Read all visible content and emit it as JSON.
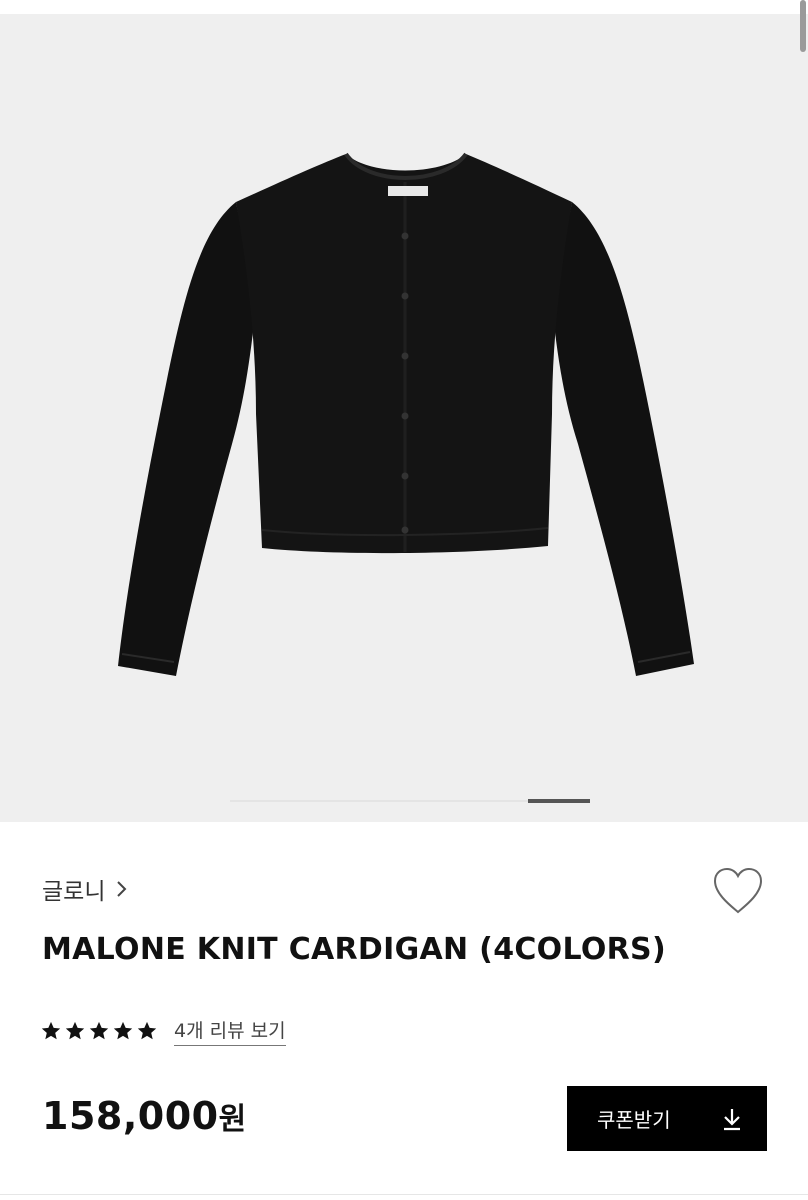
{
  "brand": {
    "name": "글로니",
    "chevron_icon": "chevron-right-icon"
  },
  "product": {
    "title": "MALONE KNIT CARDIGAN (4COLORS)",
    "image_icon": "black-knit-cardigan-photo",
    "rating_stars": 5,
    "review_link": "4개 리뷰 보기",
    "price": "158,000",
    "price_unit": "원"
  },
  "gallery": {
    "background": "#efefef",
    "active_slide_fraction": 0.83
  },
  "wishlist": {
    "icon": "heart-outline-icon"
  },
  "coupon": {
    "label": "쿠폰받기",
    "icon": "download-icon",
    "background": "#000000"
  }
}
